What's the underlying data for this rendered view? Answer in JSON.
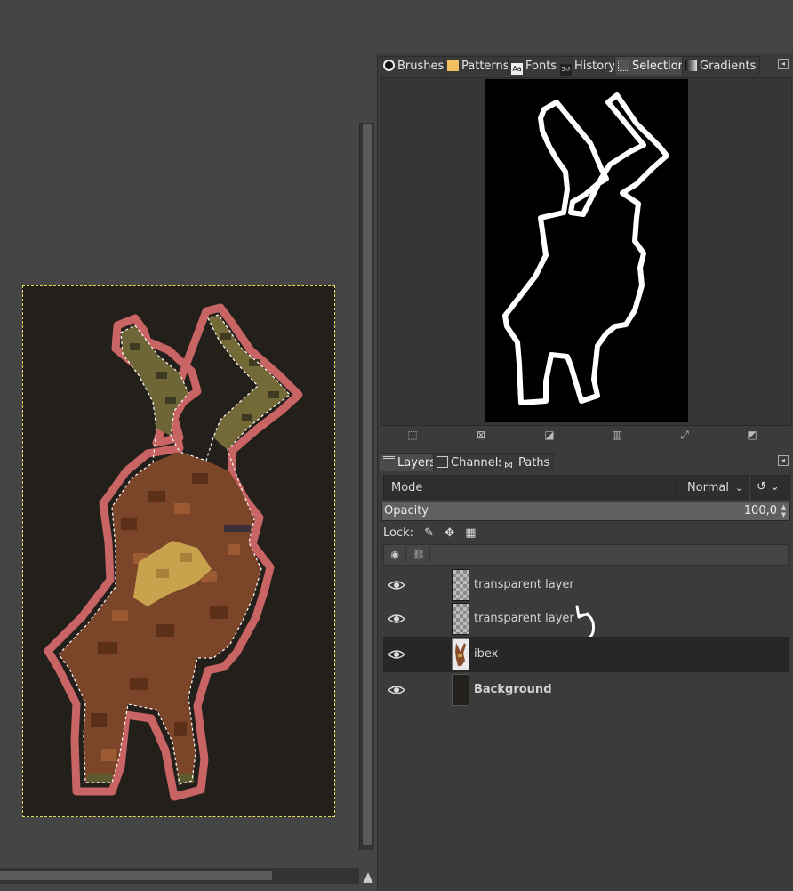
{
  "dock_tabs": [
    {
      "label": "Brushes",
      "icon": "brush-icon"
    },
    {
      "label": "Patterns",
      "icon": "pattern-icon"
    },
    {
      "label": "Fonts",
      "icon": "font-icon"
    },
    {
      "label": "History",
      "icon": "history-icon"
    },
    {
      "label": "Selection",
      "icon": "selection-icon",
      "active": true
    },
    {
      "label": "Gradients",
      "icon": "gradient-icon"
    }
  ],
  "layers_tabs": [
    {
      "label": "Layers",
      "icon": "layers-icon",
      "active": true
    },
    {
      "label": "Channels",
      "icon": "channels-icon"
    },
    {
      "label": "Paths",
      "icon": "paths-icon"
    }
  ],
  "layers_panel": {
    "mode_label": "Mode",
    "mode_value": "Normal",
    "opacity_label": "Opacity",
    "opacity_value": "100,0",
    "lock_label": "Lock:",
    "layers": [
      {
        "name": "transparent layer",
        "thumb": "checker"
      },
      {
        "name": "transparent layer",
        "thumb": "checker"
      },
      {
        "name": "ibex",
        "thumb": "ibex",
        "selected": true
      },
      {
        "name": "Background",
        "thumb": "background",
        "bold": true
      }
    ]
  },
  "colors": {
    "canvas_bg": "#454545",
    "image_bg": "#231f1b",
    "selection_outline": "#c86464",
    "marching_ants": "#e5e05a",
    "dock_bg": "#3b3b3b"
  }
}
